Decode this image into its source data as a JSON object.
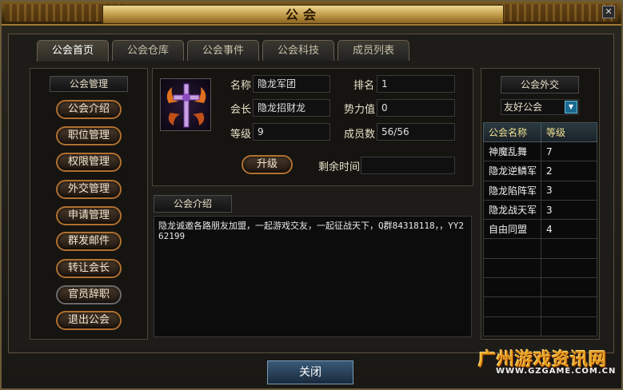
{
  "window": {
    "title": "公会"
  },
  "tabs": [
    "公会首页",
    "公会仓库",
    "公会事件",
    "公会科技",
    "成员列表"
  ],
  "left_menu": {
    "header": "公会管理",
    "items": [
      "公会介绍",
      "职位管理",
      "权限管理",
      "外交管理",
      "申请管理",
      "群发邮件",
      "转让会长",
      "官员辞职",
      "退出公会"
    ]
  },
  "info": {
    "name_label": "名称",
    "name_value": "隐龙军团",
    "leader_label": "会长",
    "leader_value": "隐龙招财龙",
    "level_label": "等级",
    "level_value": "9",
    "rank_label": "排名",
    "rank_value": "1",
    "power_label": "势力值",
    "power_value": "0",
    "members_label": "成员数",
    "members_value": "56/56",
    "upgrade_label": "升级",
    "time_label": "剩余时间",
    "time_value": ""
  },
  "intro": {
    "header": "公会介绍",
    "text": "隐龙诚邀各路朋友加盟，一起游戏交友，一起征战天下，Q群84318118，，YY262199"
  },
  "diplomacy": {
    "header": "公会外交",
    "filter": "友好公会",
    "columns": [
      "公会名称",
      "等级"
    ],
    "rows": [
      [
        "神魔乱舞",
        "7"
      ],
      [
        "隐龙逆鳞军",
        "2"
      ],
      [
        "隐龙陷阵军",
        "3"
      ],
      [
        "隐龙战天军",
        "3"
      ],
      [
        "自由同盟",
        "4"
      ]
    ]
  },
  "footer": {
    "close_label": "关闭"
  },
  "watermark": {
    "line1": "广州游戏资讯网",
    "line2": "WWW.GZGAME.COM.CN"
  }
}
